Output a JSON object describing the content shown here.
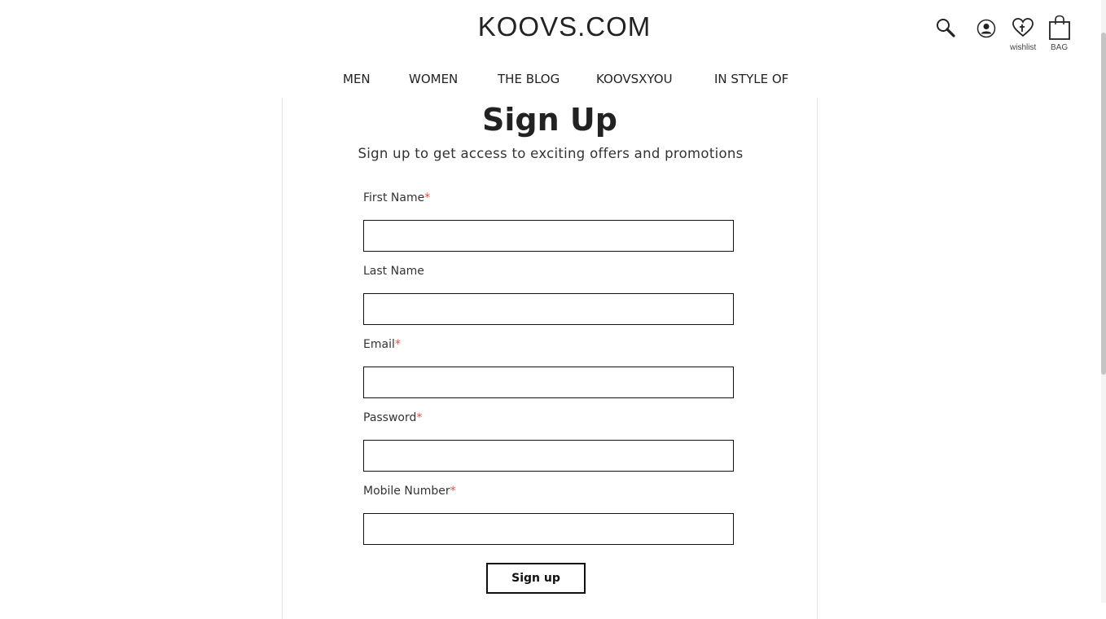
{
  "header": {
    "logo": "KOOVS.COM",
    "wishlist_label": "wishlist",
    "bag_label": "BAG"
  },
  "nav": {
    "items": [
      {
        "label": "MEN"
      },
      {
        "label": "WOMEN"
      },
      {
        "label": "THE BLOG"
      },
      {
        "label": "KOOVSXYOU"
      },
      {
        "label": "IN STYLE OF"
      }
    ]
  },
  "form": {
    "title": "Sign Up",
    "subtitle": "Sign up to get access to exciting offers and promotions",
    "required_marker": "*",
    "fields": [
      {
        "label": "First Name",
        "value": "",
        "placeholder": ""
      },
      {
        "label": "Last Name",
        "value": "",
        "placeholder": ""
      },
      {
        "label": "Email",
        "value": "",
        "placeholder": ""
      },
      {
        "label": "Password",
        "value": "",
        "placeholder": ""
      },
      {
        "label": "Mobile Number",
        "value": "",
        "placeholder": ""
      }
    ],
    "submit_label": "Sign up"
  },
  "colors": {
    "required": "#d9534f",
    "text": "#222222",
    "border": "#111111"
  }
}
